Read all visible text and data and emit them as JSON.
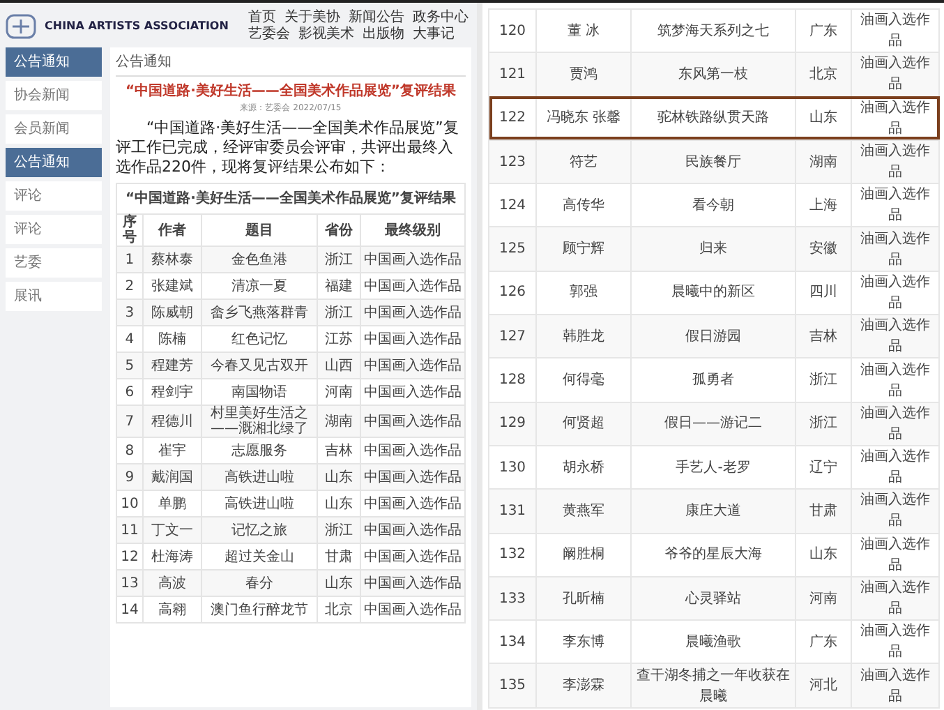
{
  "header": {
    "logo_text": "CHINA ARTISTS ASSOCIATION",
    "nav": [
      "首页",
      "关于美协",
      "新闻公告",
      "政务中心",
      "艺委会",
      "影视美术",
      "出版物",
      "大事记"
    ]
  },
  "sidebar": {
    "title": "公告通知",
    "items": [
      {
        "label": "协会新闻",
        "selected": false
      },
      {
        "label": "会员新闻",
        "selected": false
      },
      {
        "label": "公告通知",
        "selected": true
      },
      {
        "label": "评论",
        "selected": false
      },
      {
        "label": "评论",
        "selected": false
      },
      {
        "label": "艺委",
        "selected": false
      },
      {
        "label": "展讯",
        "selected": false
      }
    ]
  },
  "breadcrumb": "公告通知",
  "article": {
    "title": "“中国道路·美好生活——全国美术作品展览”复评结果",
    "meta": "来源：艺委会 2022/07/15",
    "intro": "“中国道路·美好生活——全国美术作品展览”复评工作已完成，经评审委员会评审，共评出最终入选作品220件，现将复评结果公布如下："
  },
  "left_table": {
    "caption": "“中国道路·美好生活——全国美术作品展览”复评结果",
    "columns": [
      "序号",
      "作者",
      "题目",
      "省份",
      "最终级别"
    ],
    "rows": [
      [
        "1",
        "蔡林泰",
        "金色鱼港",
        "浙江",
        "中国画入选作品"
      ],
      [
        "2",
        "张建斌",
        "清凉一夏",
        "福建",
        "中国画入选作品"
      ],
      [
        "3",
        "陈威朝",
        "畲乡飞燕落群青",
        "浙江",
        "中国画入选作品"
      ],
      [
        "4",
        "陈楠",
        "红色记忆",
        "江苏",
        "中国画入选作品"
      ],
      [
        "5",
        "程建芳",
        "今春又见古双开",
        "山西",
        "中国画入选作品"
      ],
      [
        "6",
        "程剑宇",
        "南国物语",
        "河南",
        "中国画入选作品"
      ],
      [
        "7",
        "程德川",
        "村里美好生活之——溉湘北绿了",
        "湖南",
        "中国画入选作品"
      ],
      [
        "8",
        "崔宇",
        "志愿服务",
        "吉林",
        "中国画入选作品"
      ],
      [
        "9",
        "戴润国",
        "高铁进山啦",
        "山东",
        "中国画入选作品"
      ],
      [
        "10",
        "单鹏",
        "高铁进山啦",
        "山东",
        "中国画入选作品"
      ],
      [
        "11",
        "丁文一",
        "记忆之旅",
        "浙江",
        "中国画入选作品"
      ],
      [
        "12",
        "杜海涛",
        "超过关金山",
        "甘肃",
        "中国画入选作品"
      ],
      [
        "13",
        "高波",
        "春分",
        "山东",
        "中国画入选作品"
      ],
      [
        "14",
        "高翱",
        "澳门鱼行醉龙节",
        "北京",
        "中国画入选作品"
      ]
    ]
  },
  "right_table": {
    "rows": [
      {
        "cells": [
          "120",
          "董 冰",
          "筑梦海天系列之七",
          "广东",
          "油画入选作品"
        ],
        "highlighted": false
      },
      {
        "cells": [
          "121",
          "贾鸿",
          "东风第一枝",
          "北京",
          "油画入选作品"
        ],
        "highlighted": false
      },
      {
        "cells": [
          "122",
          "冯晓东 张馨",
          "驼林铁路纵贯天路",
          "山东",
          "油画入选作品"
        ],
        "highlighted": true
      },
      {
        "cells": [
          "123",
          "符艺",
          "民族餐厅",
          "湖南",
          "油画入选作品"
        ],
        "highlighted": false
      },
      {
        "cells": [
          "124",
          "高传华",
          "看今朝",
          "上海",
          "油画入选作品"
        ],
        "highlighted": false
      },
      {
        "cells": [
          "125",
          "顾宁辉",
          "归来",
          "安徽",
          "油画入选作品"
        ],
        "highlighted": false
      },
      {
        "cells": [
          "126",
          "郭强",
          "晨曦中的新区",
          "四川",
          "油画入选作品"
        ],
        "highlighted": false
      },
      {
        "cells": [
          "127",
          "韩胜龙",
          "假日游园",
          "吉林",
          "油画入选作品"
        ],
        "highlighted": false
      },
      {
        "cells": [
          "128",
          "何得毫",
          "孤勇者",
          "浙江",
          "油画入选作品"
        ],
        "highlighted": false
      },
      {
        "cells": [
          "129",
          "何贤超",
          "假日——游记二",
          "浙江",
          "油画入选作品"
        ],
        "highlighted": false
      },
      {
        "cells": [
          "130",
          "胡永桥",
          "手艺人-老罗",
          "辽宁",
          "油画入选作品"
        ],
        "highlighted": false
      },
      {
        "cells": [
          "131",
          "黄燕军",
          "康庄大道",
          "甘肃",
          "油画入选作品"
        ],
        "highlighted": false
      },
      {
        "cells": [
          "132",
          "阚胜桐",
          "爷爷的星辰大海",
          "山东",
          "油画入选作品"
        ],
        "highlighted": false
      },
      {
        "cells": [
          "133",
          "孔昕楠",
          "心灵驿站",
          "河南",
          "油画入选作品"
        ],
        "highlighted": false
      },
      {
        "cells": [
          "134",
          "李东博",
          "晨曦渔歌",
          "广东",
          "油画入选作品"
        ],
        "highlighted": false
      },
      {
        "cells": [
          "135",
          "李澎霖",
          "查干湖冬捕之一年收获在晨曦",
          "河北",
          "油画入选作品"
        ],
        "highlighted": false
      }
    ]
  }
}
